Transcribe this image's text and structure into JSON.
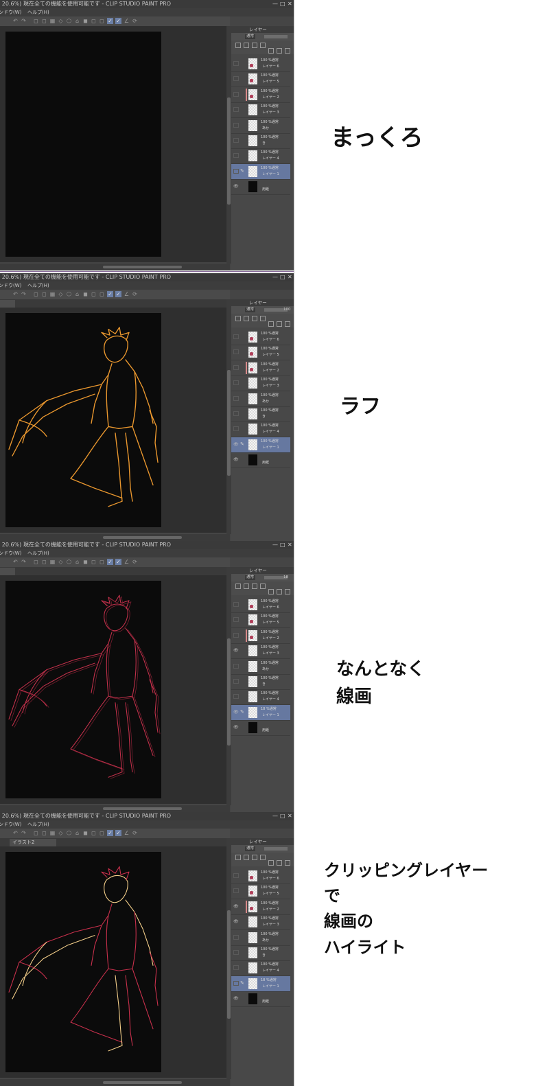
{
  "window": {
    "title": "i 20.6%)  現在全ての機能を使用可能です - CLIP STUDIO PAINT PRO",
    "controls": [
      "—",
      "□",
      "✕"
    ]
  },
  "menu": {
    "window": "ンドウ(W)",
    "help": "ヘルプ(H)"
  },
  "panels": [
    {
      "note": "まっくろ",
      "stroke_color": null,
      "tab": "",
      "opacity": "",
      "layers": [
        {
          "line1": "100 %通常",
          "line2": "レイヤー 6",
          "thumb": "red",
          "visible": false,
          "selected": false
        },
        {
          "line1": "100 %通常",
          "line2": "レイヤー 5",
          "thumb": "red",
          "visible": false,
          "selected": false
        },
        {
          "line1": "100 %通常",
          "line2": "レイヤー 2",
          "thumb": "red",
          "visible": false,
          "selected": false,
          "clip": true
        },
        {
          "line1": "100 %通常",
          "line2": "レイヤー 3",
          "thumb": "plain",
          "visible": false,
          "selected": false
        },
        {
          "line1": "100 %通常",
          "line2": "あか",
          "thumb": "plain",
          "visible": false,
          "selected": false
        },
        {
          "line1": "100 %通常",
          "line2": "き",
          "thumb": "plain",
          "visible": false,
          "selected": false
        },
        {
          "line1": "100 %通常",
          "line2": "レイヤー 4",
          "thumb": "plain",
          "visible": false,
          "selected": false
        },
        {
          "line1": "100 %通常",
          "line2": "レイヤー 1",
          "thumb": "plain",
          "visible": false,
          "selected": true,
          "pen": true
        },
        {
          "line1": "",
          "line2": "用紙",
          "thumb": "dark",
          "visible": true,
          "selected": false
        }
      ]
    },
    {
      "note": "ラフ",
      "stroke_color": "#e8962e",
      "tab": "",
      "opacity": "100",
      "layers": [
        {
          "line1": "100 %通常",
          "line2": "レイヤー 6",
          "thumb": "red",
          "visible": false,
          "selected": false
        },
        {
          "line1": "100 %通常",
          "line2": "レイヤー 5",
          "thumb": "red",
          "visible": false,
          "selected": false
        },
        {
          "line1": "100 %通常",
          "line2": "レイヤー 2",
          "thumb": "red",
          "visible": false,
          "selected": false,
          "clip": true
        },
        {
          "line1": "100 %通常",
          "line2": "レイヤー 3",
          "thumb": "plain",
          "visible": false,
          "selected": false
        },
        {
          "line1": "100 %通常",
          "line2": "あか",
          "thumb": "plain",
          "visible": false,
          "selected": false
        },
        {
          "line1": "100 %通常",
          "line2": "き",
          "thumb": "plain",
          "visible": false,
          "selected": false
        },
        {
          "line1": "100 %通常",
          "line2": "レイヤー 4",
          "thumb": "plain",
          "visible": false,
          "selected": false
        },
        {
          "line1": "100 %通常",
          "line2": "レイヤー 1",
          "thumb": "plain",
          "visible": true,
          "selected": true,
          "pen": true
        },
        {
          "line1": "",
          "line2": "用紙",
          "thumb": "dark",
          "visible": true,
          "selected": false
        }
      ]
    },
    {
      "note": "なんとなく\n線画",
      "stroke_color": "#c0304a",
      "tab": "",
      "opacity": "18",
      "layers": [
        {
          "line1": "100 %通常",
          "line2": "レイヤー 6",
          "thumb": "red",
          "visible": false,
          "selected": false
        },
        {
          "line1": "100 %通常",
          "line2": "レイヤー 5",
          "thumb": "red",
          "visible": false,
          "selected": false
        },
        {
          "line1": "100 %通常",
          "line2": "レイヤー 2",
          "thumb": "red",
          "visible": false,
          "selected": false,
          "clip": true
        },
        {
          "line1": "100 %通常",
          "line2": "レイヤー 3",
          "thumb": "plain",
          "visible": true,
          "selected": false
        },
        {
          "line1": "100 %通常",
          "line2": "あか",
          "thumb": "plain",
          "visible": false,
          "selected": false
        },
        {
          "line1": "100 %通常",
          "line2": "き",
          "thumb": "plain",
          "visible": false,
          "selected": false
        },
        {
          "line1": "100 %通常",
          "line2": "レイヤー 4",
          "thumb": "plain",
          "visible": false,
          "selected": false
        },
        {
          "line1": "18 %通常",
          "line2": "レイヤー 1",
          "thumb": "plain",
          "visible": true,
          "selected": true,
          "pen": true
        },
        {
          "line1": "",
          "line2": "用紙",
          "thumb": "dark",
          "visible": true,
          "selected": false
        }
      ]
    },
    {
      "note": "クリッピングレイヤー\nで\n線画の\nハイライト",
      "stroke_color": "#c8304c",
      "tab": "イラスト2",
      "opacity": "",
      "layers": [
        {
          "line1": "100 %通常",
          "line2": "レイヤー 6",
          "thumb": "red",
          "visible": false,
          "selected": false
        },
        {
          "line1": "100 %通常",
          "line2": "レイヤー 5",
          "thumb": "red",
          "visible": false,
          "selected": false
        },
        {
          "line1": "100 %通常",
          "line2": "レイヤー 2",
          "thumb": "red",
          "visible": true,
          "selected": false,
          "clip": true
        },
        {
          "line1": "100 %通常",
          "line2": "レイヤー 3",
          "thumb": "plain",
          "visible": true,
          "selected": false
        },
        {
          "line1": "100 %通常",
          "line2": "あか",
          "thumb": "plain",
          "visible": false,
          "selected": false
        },
        {
          "line1": "100 %通常",
          "line2": "き",
          "thumb": "plain",
          "visible": false,
          "selected": false
        },
        {
          "line1": "100 %通常",
          "line2": "レイヤー 4",
          "thumb": "plain",
          "visible": false,
          "selected": false
        },
        {
          "line1": "18 %通常",
          "line2": "レイヤー 1",
          "thumb": "plain",
          "visible": false,
          "selected": true,
          "pen": true
        },
        {
          "line1": "",
          "line2": "用紙",
          "thumb": "dark",
          "visible": true,
          "selected": false
        }
      ]
    }
  ],
  "layer_panel": {
    "header": "レイヤー",
    "blend_mode": "通常"
  },
  "icons": {
    "eye": "eye-icon",
    "pen": "pen-icon",
    "undo": "undo-icon",
    "redo": "redo-icon"
  }
}
